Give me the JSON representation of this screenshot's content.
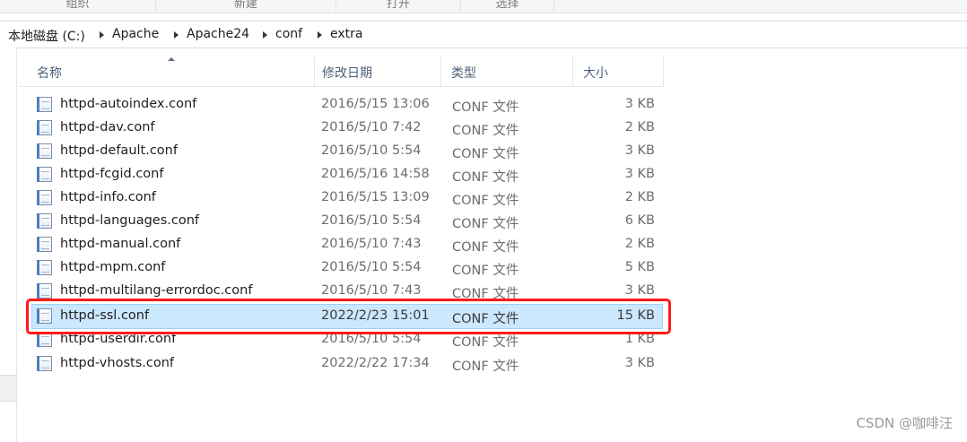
{
  "ribbon": {
    "groups": [
      "组织",
      "新建",
      "打开",
      "选择"
    ]
  },
  "breadcrumb": [
    "本地磁盘 (C:)",
    "Apache",
    "Apache24",
    "conf",
    "extra"
  ],
  "columns": {
    "name": "名称",
    "date": "修改日期",
    "type": "类型",
    "size": "大小"
  },
  "files": [
    {
      "name": "httpd-autoindex.conf",
      "date": "2016/5/15 13:06",
      "type": "CONF 文件",
      "size": "3 KB"
    },
    {
      "name": "httpd-dav.conf",
      "date": "2016/5/10 7:42",
      "type": "CONF 文件",
      "size": "2 KB"
    },
    {
      "name": "httpd-default.conf",
      "date": "2016/5/10 5:54",
      "type": "CONF 文件",
      "size": "3 KB"
    },
    {
      "name": "httpd-fcgid.conf",
      "date": "2016/5/16 14:58",
      "type": "CONF 文件",
      "size": "3 KB"
    },
    {
      "name": "httpd-info.conf",
      "date": "2016/5/15 13:09",
      "type": "CONF 文件",
      "size": "2 KB"
    },
    {
      "name": "httpd-languages.conf",
      "date": "2016/5/10 5:54",
      "type": "CONF 文件",
      "size": "6 KB"
    },
    {
      "name": "httpd-manual.conf",
      "date": "2016/5/10 7:43",
      "type": "CONF 文件",
      "size": "2 KB"
    },
    {
      "name": "httpd-mpm.conf",
      "date": "2016/5/10 5:54",
      "type": "CONF 文件",
      "size": "5 KB"
    },
    {
      "name": "httpd-multilang-errordoc.conf",
      "date": "2016/5/10 7:43",
      "type": "CONF 文件",
      "size": "3 KB"
    },
    {
      "name": "httpd-ssl.conf",
      "date": "2022/2/23 15:01",
      "type": "CONF 文件",
      "size": "15 KB",
      "selected": true
    },
    {
      "name": "httpd-userdir.conf",
      "date": "2016/5/10 5:54",
      "type": "CONF 文件",
      "size": "1 KB"
    },
    {
      "name": "httpd-vhosts.conf",
      "date": "2022/2/22 17:34",
      "type": "CONF 文件",
      "size": "3 KB"
    }
  ],
  "highlight_color": "#ff1a1a",
  "selection_color": "#cce8ff",
  "watermark": "CSDN @咖啡汪"
}
